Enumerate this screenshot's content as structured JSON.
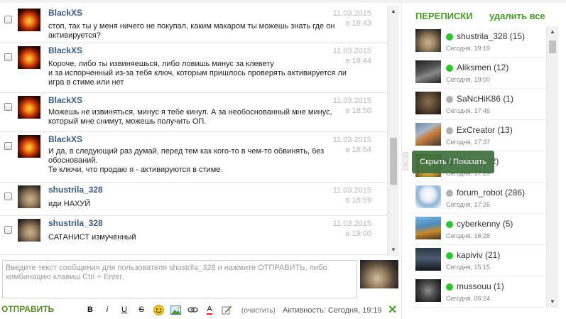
{
  "messages": [
    {
      "author": "BlackXS",
      "date": "11.03.2015",
      "time": "в 18:43",
      "text": "стоп, так ты у меня ничего не покупал, каким макаром ты можешь знать где он активируется?",
      "avatar": "fire-avatar"
    },
    {
      "author": "BlackXS",
      "date": "11.03.2015",
      "time": "в 18:44",
      "text": "Короче, либо ты извиняешься, либо ловишь минус за клевету\nи за испорченный из-за тебя ключ, которым пришлось проверять активируется ли игра в стиме или нет",
      "avatar": "fire-avatar"
    },
    {
      "author": "BlackXS",
      "date": "11.03.2015",
      "time": "в 18:50",
      "text": "Можешь не извиняться, минус я тебе кинул. А за необоснованный мне минус, который мне снимут, можешь получить ОП.",
      "avatar": "fire-avatar"
    },
    {
      "author": "BlackXS",
      "date": "11.03.2015",
      "time": "в 18:54",
      "text": "И да, в следующий раз думай, перед тем как кого-то в чем-то обвинять, без обоснований.\nТе ключи, что продаю я - активируются в стиме.",
      "avatar": "fire-avatar"
    },
    {
      "author": "shustrila_328",
      "date": "11.03.2015",
      "time": "в 18:59",
      "text": "иди НАХУЙ",
      "avatar": "pug-avatar"
    },
    {
      "author": "shustrila_328",
      "date": "11.03.2015",
      "time": "в 19:00",
      "text": "САТАНИСТ измученный",
      "avatar": "pug-avatar"
    }
  ],
  "composer": {
    "placeholder": "Введите текст сообщения для пользователя shustrila_328 и нажмите ОТПРАВИТЬ, либо комбинацию клавиш Ctrl + Enter.",
    "send_label": "ОТПРАВИТЬ",
    "clear_label": "(очистить)",
    "activity": "Активность: Сегодня, 19:19",
    "tools": [
      {
        "label": "B",
        "icon": "bold-icon"
      },
      {
        "label": "i",
        "icon": "italic-icon"
      },
      {
        "label": "U",
        "icon": "underline-icon"
      },
      {
        "label": "S",
        "icon": "strike-icon"
      },
      {
        "label": "",
        "icon": "smiley-icon"
      },
      {
        "label": "",
        "icon": "image-icon"
      },
      {
        "label": "",
        "icon": "link-icon"
      },
      {
        "label": "A",
        "icon": "text-color-icon"
      },
      {
        "label": "",
        "icon": "edit-icon"
      }
    ]
  },
  "sidebar": {
    "title": "ПЕРЕПИСКИ",
    "delete_all": "удалить все",
    "tooltip": "Скрыть / Показать",
    "contacts": [
      {
        "name": "shustrila_328 (15)",
        "time": "Сегодня, 19:19",
        "status": "online",
        "avatar": "pug-avatar"
      },
      {
        "name": "Aliksmen (12)",
        "time": "Сегодня, 19:00",
        "status": "online",
        "avatar": "soldier-avatar"
      },
      {
        "name": "SaNcHiK86 (1)",
        "time": "Сегодня, 17:46",
        "status": "offline",
        "avatar": "man-avatar"
      },
      {
        "name": "ExCreator (13)",
        "time": "Сегодня, 17:37",
        "status": "offline",
        "avatar": "game-avatar"
      },
      {
        "name": "Keepon (2)",
        "time": "Сегодня, 17:29",
        "status": "online",
        "avatar": "keepon-avatar"
      },
      {
        "name": "forum_robot (286)",
        "time": "Сегодня, 17:26",
        "status": "offline",
        "avatar": "robot-avatar"
      },
      {
        "name": "cyberkenny (5)",
        "time": "Сегодня, 16:28",
        "status": "online",
        "avatar": "walle-avatar"
      },
      {
        "name": "kapiviv (21)",
        "time": "Сегодня, 15:15",
        "status": "online",
        "avatar": "dark-avatar"
      },
      {
        "name": "mussouu (1)",
        "time": "Сегодня, 06:24",
        "status": "online",
        "avatar": "shadow-avatar"
      }
    ]
  },
  "colors": {
    "accent": "#4a9a2c",
    "author": "#3a5b7e",
    "online": "#2fc22f",
    "offline": "#b0b0b0"
  }
}
